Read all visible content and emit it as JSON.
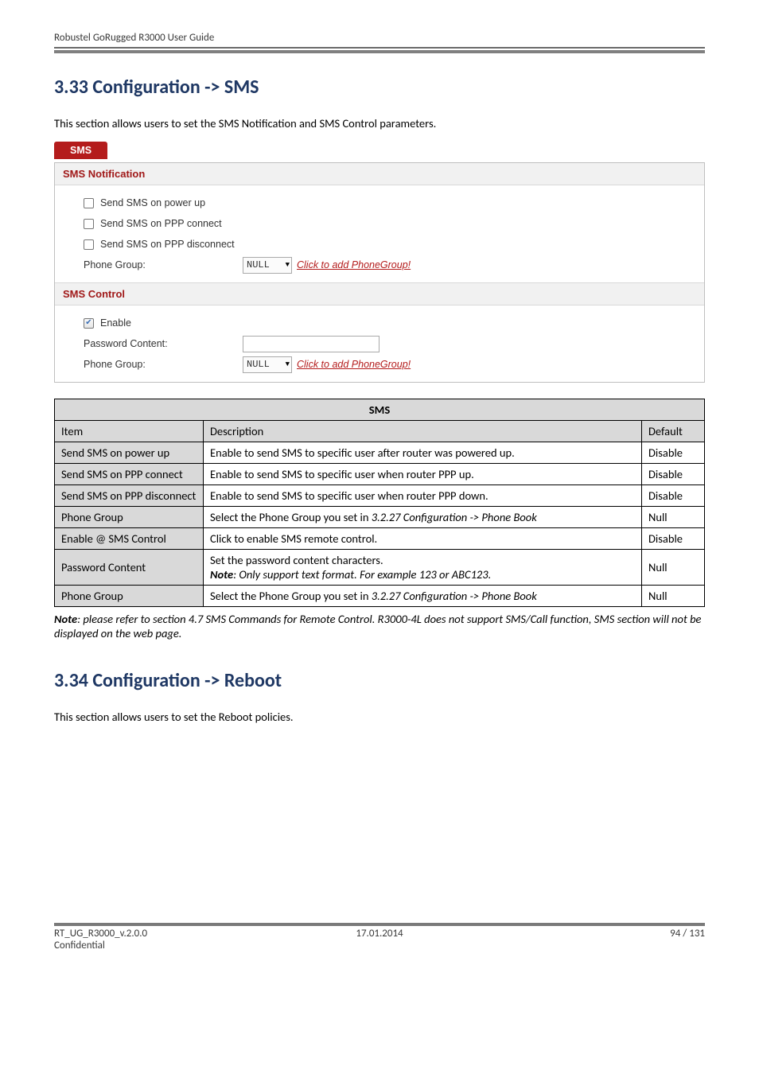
{
  "header": {
    "running": "Robustel GoRugged R3000 User Guide"
  },
  "section33": {
    "heading": "3.33  Configuration -> SMS",
    "intro": "This section allows users to set the SMS Notification and SMS Control parameters.",
    "panel": {
      "tab": "SMS",
      "notification": {
        "title": "SMS Notification",
        "rows": {
          "power_up": "Send SMS on power up",
          "ppp_connect": "Send SMS on PPP connect",
          "ppp_disconnect": "Send SMS on PPP disconnect",
          "phone_group_label": "Phone Group:",
          "phone_group_value": "NULL",
          "phone_group_link": "Click to add PhoneGroup!"
        }
      },
      "control": {
        "title": "SMS Control",
        "rows": {
          "enable": "Enable",
          "password_content_label": "Password Content:",
          "phone_group_label": "Phone Group:",
          "phone_group_value": "NULL",
          "phone_group_link": "Click to add PhoneGroup!"
        }
      }
    },
    "table": {
      "title": "SMS",
      "head": {
        "item": "Item",
        "desc": "Description",
        "def": "Default"
      },
      "rows": [
        {
          "item": "Send SMS on power up",
          "desc": "Enable to send SMS to specific user after router was powered up.",
          "def": "Disable"
        },
        {
          "item": "Send SMS on PPP connect",
          "desc": "Enable to send SMS to specific user when router PPP up.",
          "def": "Disable"
        },
        {
          "item": "Send SMS on PPP disconnect",
          "desc": "Enable to send SMS to specific user when router PPP down.",
          "def": "Disable"
        },
        {
          "item": "Phone Group",
          "desc_prefix": "Select the Phone Group you set in ",
          "desc_italic": "3.2.27 Configuration -> Phone Book",
          "def": "Null"
        },
        {
          "item": "Enable @ SMS Control",
          "desc": "Click to enable SMS remote control.",
          "def": "Disable"
        },
        {
          "item": "Password Content",
          "desc_line1": "Set the password content characters.",
          "desc_line2_bold": "Note",
          "desc_line2_rest": ": Only support text format. For example 123 or ABC123.",
          "def": "Null"
        },
        {
          "item": "Phone Group",
          "desc_prefix": "Select the Phone Group you set in ",
          "desc_italic": "3.2.27 Configuration -> Phone Book",
          "def": "Null"
        }
      ]
    },
    "note_bold": "Note",
    "note_rest": ": please refer to section 4.7 SMS Commands for Remote Control. R3000-4L does not support SMS/Call function, SMS section will not be displayed on the web page."
  },
  "section34": {
    "heading": "3.34  Configuration -> Reboot",
    "intro": "This section allows users to set the Reboot policies."
  },
  "footer": {
    "left": "RT_UG_R3000_v.2.0.0",
    "left2": "Confidential",
    "center": "17.01.2014",
    "right": "94 / 131"
  }
}
